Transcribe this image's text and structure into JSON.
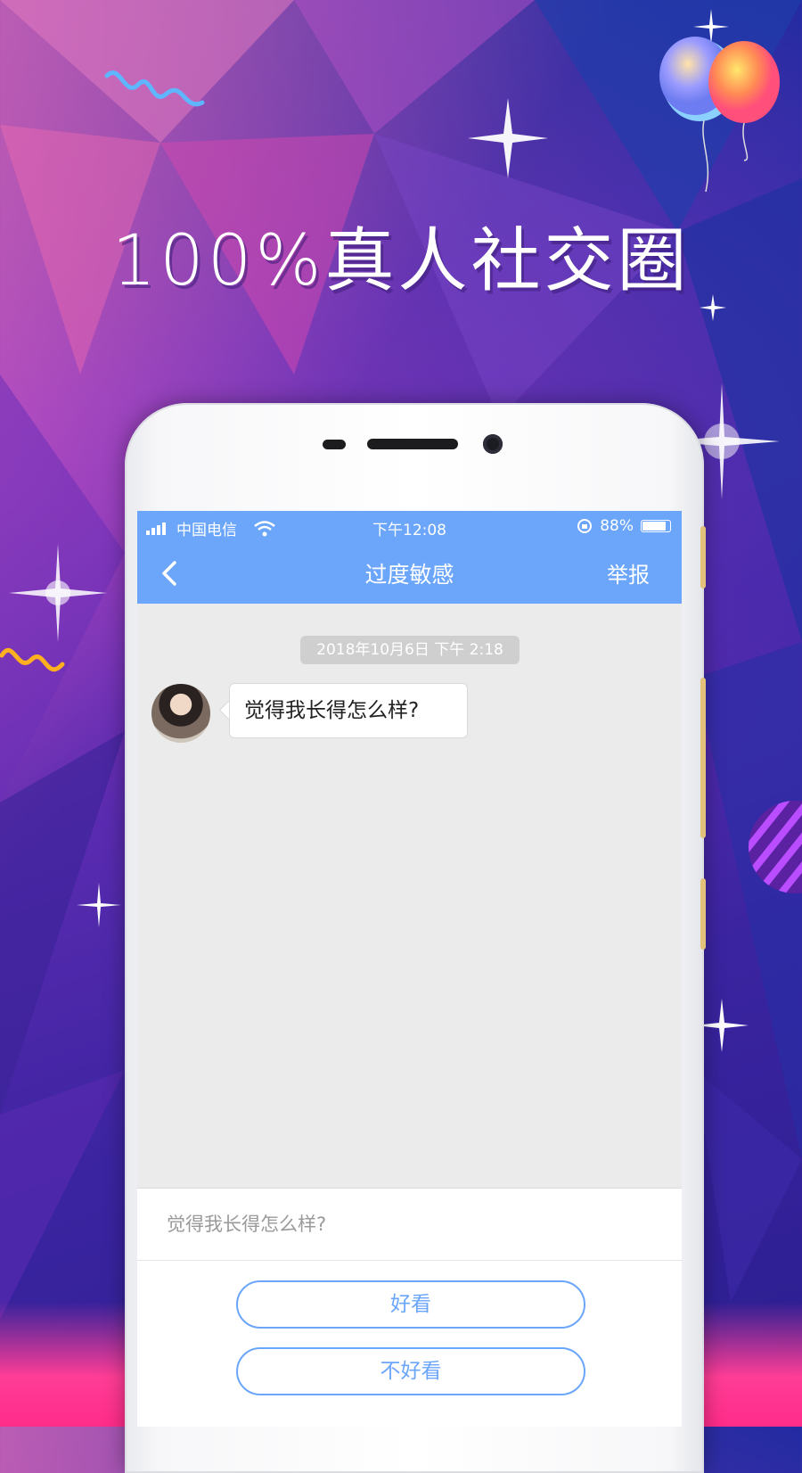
{
  "headline": "100%真人社交圈",
  "status_bar": {
    "carrier": "中国电信",
    "time": "下午12:08",
    "battery_percent": "88%",
    "battery_level": 0.88
  },
  "nav": {
    "title": "过度敏感",
    "report_label": "举报"
  },
  "chat": {
    "timestamp": "2018年10月6日 下午 2:18",
    "messages": [
      {
        "text": "觉得我长得怎么样?"
      }
    ]
  },
  "reply_panel": {
    "prompt": "觉得我长得怎么样?",
    "options": [
      "好看",
      "不好看"
    ]
  },
  "colors": {
    "accent": "#6ba6fb",
    "timestamp_bg": "#cfcfcf"
  }
}
